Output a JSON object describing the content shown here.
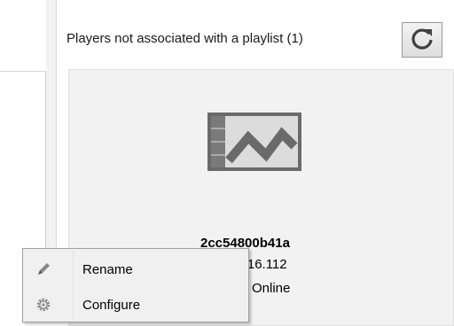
{
  "players_section": {
    "title": "Players not associated with a playlist (1)",
    "refresh_icon": "refresh-icon"
  },
  "player": {
    "icon": "player-logo-icon",
    "id": "2cc54800b41a",
    "ip_partial": "16.16.112",
    "status_partial": "Online"
  },
  "context_menu": {
    "items": [
      {
        "label": "Rename",
        "icon": "pencil-icon"
      },
      {
        "label": "Configure",
        "icon": "gear-icon"
      }
    ]
  },
  "colors": {
    "panel_bg": "#f2f2f2",
    "menu_bg": "#f0f0f0",
    "logo_gray": "#5a5a5a"
  }
}
